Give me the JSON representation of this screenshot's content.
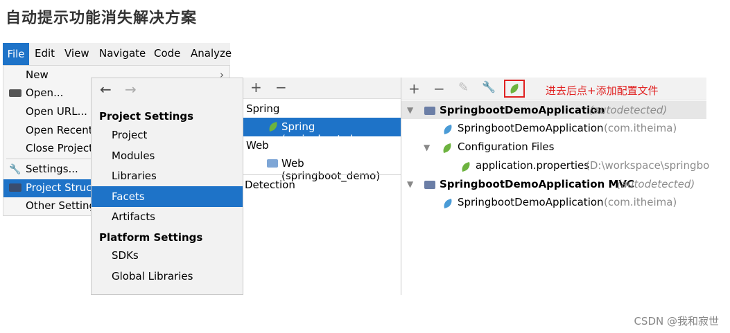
{
  "title": "自动提示功能消失解决方案",
  "menubar": {
    "items": [
      "File",
      "Edit",
      "View",
      "Navigate",
      "Code",
      "Analyze"
    ]
  },
  "file_menu": {
    "items": [
      {
        "label": "New",
        "arrow": "›"
      },
      {
        "label": "Open..."
      },
      {
        "label": "Open URL..."
      },
      {
        "label": "Open Recent"
      },
      {
        "label": "Close Project"
      },
      {
        "label": "Settings..."
      },
      {
        "label": "Project Struct"
      },
      {
        "label": "Other Setting"
      }
    ]
  },
  "project_structure": {
    "nav_back": "←",
    "nav_forward": "→",
    "project_settings_heading": "Project Settings",
    "project_items": [
      "Project",
      "Modules",
      "Libraries",
      "Facets",
      "Artifacts"
    ],
    "platform_settings_heading": "Platform Settings",
    "platform_items": [
      "SDKs",
      "Global Libraries"
    ],
    "selected": "Facets"
  },
  "facets": {
    "toolbar": {
      "add": "+",
      "remove": "−"
    },
    "spring_group": "Spring",
    "spring_item": "Spring (springboot_dem",
    "web_group": "Web",
    "web_item": "Web (springboot_demo)",
    "detection": "Detection"
  },
  "tree": {
    "toolbar": {
      "add": "+",
      "remove": "−",
      "edit": "✎",
      "wrench": "🔧"
    },
    "annotation": "进去后点+添加配置文件",
    "rows": [
      {
        "text": "SpringbootDemoApplication",
        "suffix": "(autodetected)"
      },
      {
        "text": "SpringbootDemoApplication",
        "suffix": "(com.itheima)"
      },
      {
        "text": "Configuration Files"
      },
      {
        "text": "application.properties",
        "suffix": "(D:\\workspace\\springbo"
      },
      {
        "text": "SpringbootDemoApplication MVC",
        "suffix": "(autodetected)"
      },
      {
        "text": "SpringbootDemoApplication",
        "suffix": "(com.itheima)"
      }
    ],
    "colors": {
      "accent": "#1e73c8",
      "highlight": "#e02020",
      "spring_green": "#6db33f"
    }
  },
  "watermark": "CSDN @我和寂世"
}
